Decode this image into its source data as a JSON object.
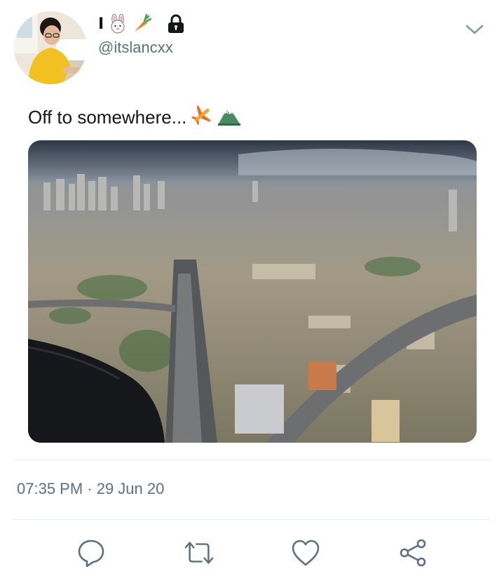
{
  "user": {
    "display_name": "I",
    "display_name_emoji": [
      "rabbit-face-icon",
      "carrot-icon"
    ],
    "protected": true,
    "handle": "@itslancxx",
    "avatar": "profile-photo"
  },
  "tweet": {
    "text": "Off to somewhere...",
    "text_emoji": [
      "airplane-icon",
      "mountain-icon"
    ],
    "media": "aerial-city-view-photo",
    "timestamp": "07:35 PM · 29 Jun 20"
  },
  "actions": [
    "reply-icon",
    "retweet-icon",
    "like-icon",
    "share-icon"
  ],
  "colors": {
    "text_primary": "#14171a",
    "text_secondary": "#5b7083",
    "icon": "#5b7083",
    "divider": "#e6ecf0"
  }
}
